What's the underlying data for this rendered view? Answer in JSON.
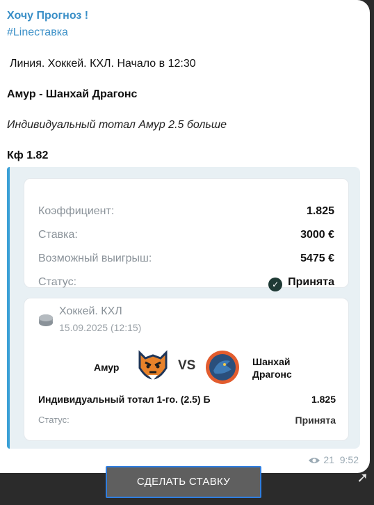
{
  "post": {
    "channel_title": "Хочу Прогноз !",
    "hashtag": "#Lineставка",
    "line_info": "Линия. Хоккей. КХЛ. Начало в 12:30",
    "match": "Амур -  Шанхай Драгонс",
    "bet_desc": "Индивидуальный тотал Амур 2.5 больше",
    "kf": "Кф 1.82"
  },
  "summary": {
    "odds_label": "Коэффициент:",
    "odds_value": "1.825",
    "stake_label": "Ставка:",
    "stake_value": "3000 €",
    "win_label": "Возможный выигрыш:",
    "win_value": "5475 €",
    "status_label": "Статус:",
    "status_value": "Принята"
  },
  "event": {
    "league": "Хоккей. КХЛ",
    "date": "15.09.2025 (12:15)",
    "team1": "Амур",
    "vs": "VS",
    "team2_line1": "Шанхай",
    "team2_line2": "Драгонс",
    "market": "Индивидуальный тотал 1-го. (2.5) Б",
    "market_odds": "1.825",
    "status_label": "Статус:",
    "status_value": "Принята"
  },
  "meta": {
    "views": "21",
    "time": "9:52"
  },
  "cta": {
    "label": "СДЕЛАТЬ СТАВКУ"
  },
  "colors": {
    "accent": "#3a8fc7",
    "bar": "#2b2b2b",
    "cta_border": "#2f7ee0"
  }
}
